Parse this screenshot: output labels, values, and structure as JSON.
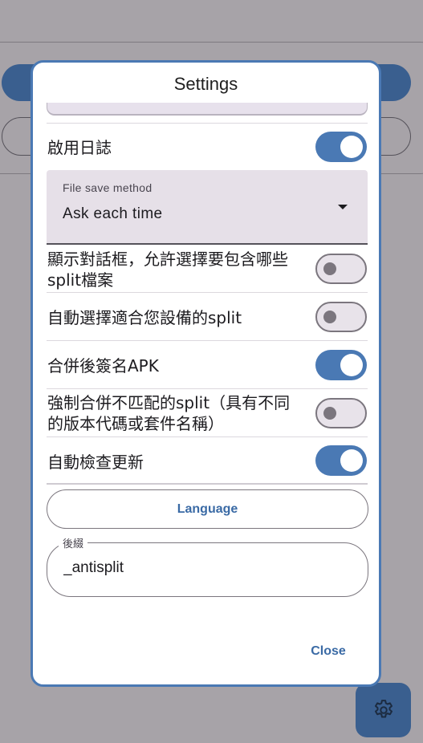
{
  "dialog": {
    "title": "Settings",
    "settings": [
      {
        "label": "啟用日誌",
        "enabled": true
      },
      {
        "label": "顯示對話框，允許選擇要包含哪些split檔案",
        "enabled": false
      },
      {
        "label": "自動選擇適合您設備的split",
        "enabled": false
      },
      {
        "label": "合併後簽名APK",
        "enabled": true
      },
      {
        "label": "強制合併不匹配的split（具有不同的版本代碼或套件名稱）",
        "enabled": false
      },
      {
        "label": "自動檢查更新",
        "enabled": true
      }
    ],
    "file_save_method": {
      "label": "File save method",
      "value": "Ask each time"
    },
    "language_button": "Language",
    "suffix_field": {
      "label": "後綴",
      "value": "_antisplit"
    },
    "close_button": "Close"
  },
  "fab": {
    "icon": "gear-icon"
  },
  "colors": {
    "accent": "#4a79b4",
    "scrim": "#a7a3a8",
    "button_text": "#3a6aa5"
  }
}
